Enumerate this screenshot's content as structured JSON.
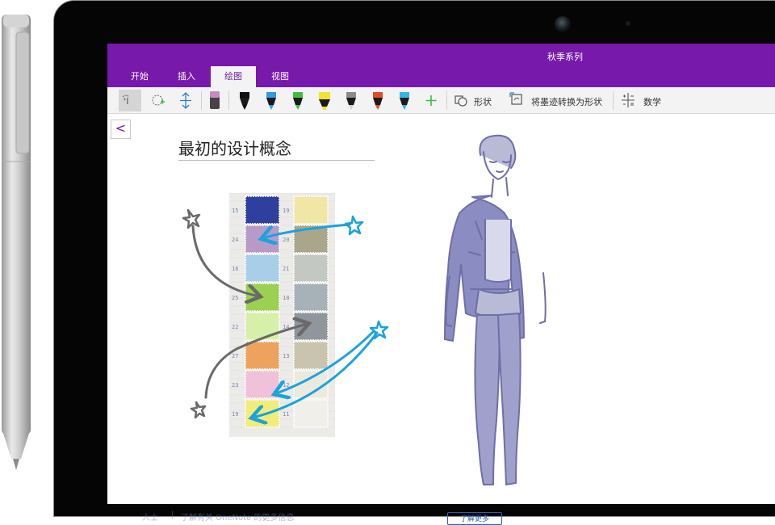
{
  "app": {
    "notebook_title": "秋季系列",
    "tabs": [
      {
        "label": "开始",
        "active": false
      },
      {
        "label": "插入",
        "active": false
      },
      {
        "label": "绘图",
        "active": true
      },
      {
        "label": "视图",
        "active": false
      }
    ],
    "toolbar": {
      "shapes_label": "形状",
      "ink_to_shape_label": "将墨迹转换为形状",
      "math_label": "数学",
      "pens": [
        {
          "icon": "lasso-type-icon"
        },
        {
          "icon": "lasso-select-icon"
        },
        {
          "icon": "insert-space-icon"
        },
        {
          "icon": "eraser-icon",
          "color": "#c48cc0"
        },
        {
          "icon": "pen-icon",
          "color": "#111111"
        },
        {
          "icon": "pen-icon",
          "color": "#2f9be0"
        },
        {
          "icon": "pen-icon",
          "color": "#3fbd3f"
        },
        {
          "icon": "highlighter-icon",
          "color": "#f3e32a"
        },
        {
          "icon": "pencil-icon",
          "color": "#8a8a8a"
        },
        {
          "icon": "pen-icon",
          "color": "#e04a2a"
        },
        {
          "icon": "pen-icon",
          "color": "#2fb7e6"
        },
        {
          "icon": "add-pen-icon",
          "color": "#3fbd3f"
        }
      ]
    },
    "accent_color": "#7719aa"
  },
  "page": {
    "back_label": "<",
    "title": "最初的设计概念",
    "swatches": {
      "left_column_colors": [
        "#2f3f9e",
        "#b79ac7",
        "#a9cfe8",
        "#9bd052",
        "#d7f0a9",
        "#eda35e",
        "#efc2d9",
        "#f2ec7a"
      ],
      "right_column_colors": [
        "#f0e6a6",
        "#a9a68b",
        "#c4c8c2",
        "#a7b2b8",
        "#8f979c",
        "#c9c4ad",
        "#ece9dd",
        "#f0efea"
      ],
      "row_numbers": [
        "15",
        "24",
        "16",
        "25",
        "22",
        "27",
        "23",
        "19"
      ],
      "right_numbers": [
        "19",
        "20",
        "21",
        "18",
        "14",
        "13",
        "12",
        "11"
      ]
    }
  },
  "footer": {
    "text_parts": [
      "人士",
      "|",
      "了解有关 OneNote 的更多信息",
      "了解更多"
    ]
  }
}
